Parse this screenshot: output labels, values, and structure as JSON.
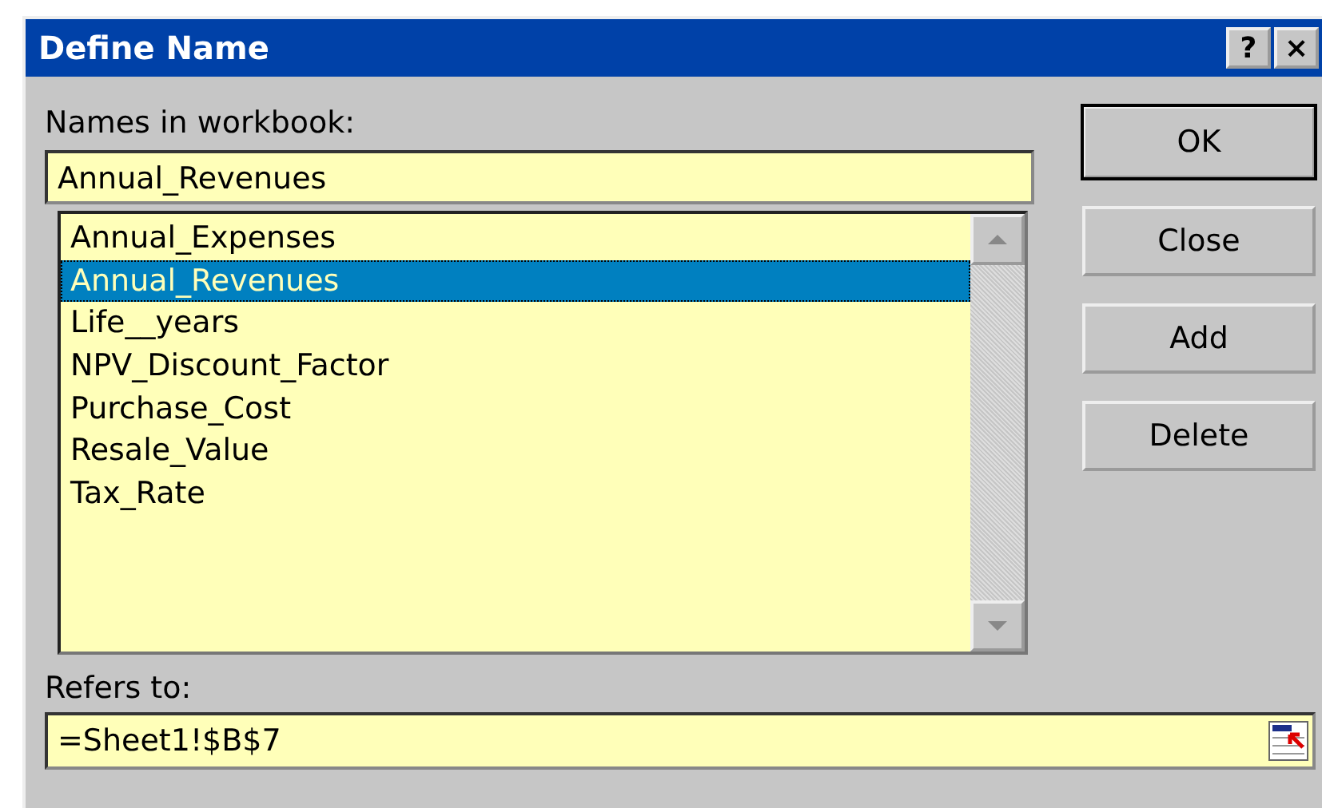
{
  "window": {
    "title": "Define Name",
    "title_buttons": [
      "?",
      "×"
    ]
  },
  "names_label": "Names in workbook:",
  "name_field": {
    "value": "Annual_Revenues"
  },
  "names": [
    {
      "label": "Annual_Expenses",
      "selected": false
    },
    {
      "label": "Annual_Revenues",
      "selected": true
    },
    {
      "label": "Life__years",
      "selected": false
    },
    {
      "label": "NPV_Discount_Factor",
      "selected": false
    },
    {
      "label": "Purchase_Cost",
      "selected": false
    },
    {
      "label": "Resale_Value",
      "selected": false
    },
    {
      "label": "Tax_Rate",
      "selected": false
    }
  ],
  "buttons": [
    {
      "label": "OK",
      "default": true
    },
    {
      "label": "Close",
      "default": false
    },
    {
      "label": "Add",
      "default": false
    },
    {
      "label": "Delete",
      "default": false
    }
  ],
  "refers_label": "Refers to:",
  "refers_field": {
    "value": "=Sheet1!$B$7"
  }
}
